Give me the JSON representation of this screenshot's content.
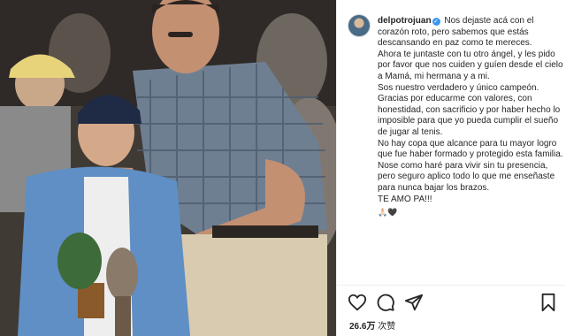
{
  "post": {
    "username": "delpotrojuan",
    "verified_mark": "✓",
    "caption_first": "Nos dejaste acá con el corazón roto, pero sabemos que estás descansando en paz como te mereces.",
    "caption_lines": [
      "Ahora te juntaste con tu otro ángel, y les pido por favor que nos cuiden y guíen desde el cielo a Mamá, mi hermana y a mi.",
      "Sos nuestro verdadero y único campeón.",
      "Gracias por educarme con valores, con honestidad, con sacrificio y por haber hecho lo imposible para que yo pueda cumplir el sueño de jugar al tenis.",
      "No hay copa que alcance para tu mayor logro que fue haber formado y protegido esta familia.",
      "Nose como haré para vivir sin tu presencia, pero seguro aplico todo lo que me enseñaste para nunca bajar los brazos.",
      "TE AMO PA!!!"
    ],
    "emoji_tail": "🙏🏻🖤",
    "likes_count": "26.6万",
    "likes_suffix": "次赞"
  },
  "icons": {
    "like": "heart-icon",
    "comment": "comment-icon",
    "share": "share-icon",
    "save": "bookmark-icon"
  }
}
